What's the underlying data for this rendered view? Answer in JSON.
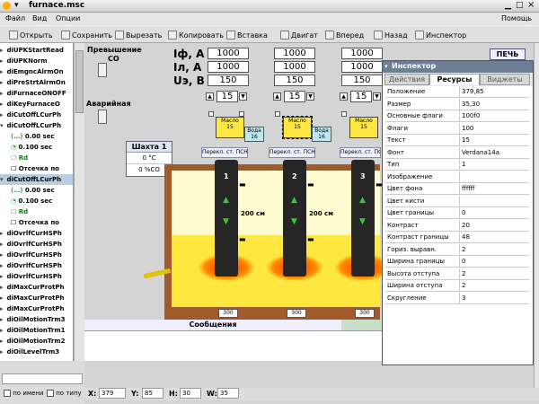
{
  "window": {
    "title": "furnace.msc",
    "help": "Помощь"
  },
  "menu": [
    "Файл",
    "Вид",
    "Опции"
  ],
  "toolbar": [
    "Открыть",
    "Сохранить",
    "Вырезать",
    "Копировать",
    "Вставка",
    "Двигат",
    "Вперед",
    "Назад",
    "Инспектор"
  ],
  "tree": {
    "items": [
      "diUPKStartRead",
      "diUPKNorm",
      "diEmgncAlrmOn",
      "diPreStrtAlrmOn",
      "diFurnaceONOFF",
      "diKeyFurnaceO",
      "diCutOffLCurPh",
      "diCutOffLCurPh"
    ],
    "sub1": [
      "0.00 sec",
      "0.100 sec",
      "Rd",
      "Отсечка по"
    ],
    "sel": "diCutOffLCurPh",
    "sub2": [
      "0.00 sec",
      "0.100 sec",
      "Rd",
      "Отсечка по"
    ],
    "items2": [
      "diOvrlfCurHSPh",
      "diOvrlfCurHSPh",
      "diOvrlfCurHSPh",
      "diOvrlfCurHSPh",
      "diOvrlfCurHSPh",
      "diMaxCurProtPh",
      "diMaxCurProtPh",
      "diMaxCurProtPh",
      "diOilMotionTrm3",
      "diOilMotionTrm1",
      "diOilMotionTrm2",
      "diOilLevelTrm3"
    ],
    "filter1": "по имени",
    "filter2": "по типу"
  },
  "canvas": {
    "co_label": "Превышение",
    "co_sub": "CO",
    "emerg_label": "Аварийная",
    "row_labels": [
      "Iф, A",
      "Iл, A",
      "Uэ, B"
    ],
    "values": [
      [
        "1000",
        "1000",
        "1000"
      ],
      [
        "1000",
        "1000",
        "1000"
      ],
      [
        "150",
        "150",
        "150"
      ]
    ],
    "steps": [
      "15",
      "15",
      "15"
    ],
    "oil_title": "Масло",
    "oil_vals": [
      "15",
      "15",
      "15"
    ],
    "water_title": "Вода",
    "water_vals": [
      "16",
      "16"
    ],
    "switch_label": "Перекл. ст. ПСН",
    "shaft_title": "Шахта 1",
    "shaft_temp": "0",
    "shaft_temp_unit": "°C",
    "shaft_co": "0",
    "shaft_co_unit": "%CO",
    "electrode_nums": [
      "1",
      "2",
      "3"
    ],
    "pos_label": "200  см",
    "bottom_vals": [
      "300",
      "300",
      "300"
    ],
    "furnace_btn": "ПЕЧЬ",
    "messages_title": "Сообщения"
  },
  "inspector": {
    "title": "Инспектор",
    "tabs": [
      "Действия",
      "Ресурсы",
      "Виджеты"
    ],
    "active_tab": "Ресурсы",
    "props": [
      [
        "Положение",
        "379,85"
      ],
      [
        "Размер",
        "35,30"
      ],
      [
        "Основные флаги",
        "100f0"
      ],
      [
        "Флаги",
        "100"
      ],
      [
        "Текст",
        "15"
      ],
      [
        "Фонт",
        "Verdana14a"
      ],
      [
        "Тип",
        "1"
      ],
      [
        "Изображение",
        ""
      ],
      [
        "Цвет фона",
        "ffffff"
      ],
      [
        "Цвет кисти",
        ""
      ],
      [
        "Цвет границы",
        "0"
      ],
      [
        "Контраст",
        "20"
      ],
      [
        "Контраст границы",
        "48"
      ],
      [
        "Гориз. выравн.",
        "2"
      ],
      [
        "Ширина границы",
        "0"
      ],
      [
        "Высота отступа",
        "2"
      ],
      [
        "Ширина отступа",
        "2"
      ],
      [
        "Скругление",
        "3"
      ]
    ]
  },
  "status": {
    "x_label": "X:",
    "x": "379",
    "y_label": "Y:",
    "y": "85",
    "h_label": "H:",
    "h": "30",
    "w_label": "W:",
    "w": "35"
  }
}
